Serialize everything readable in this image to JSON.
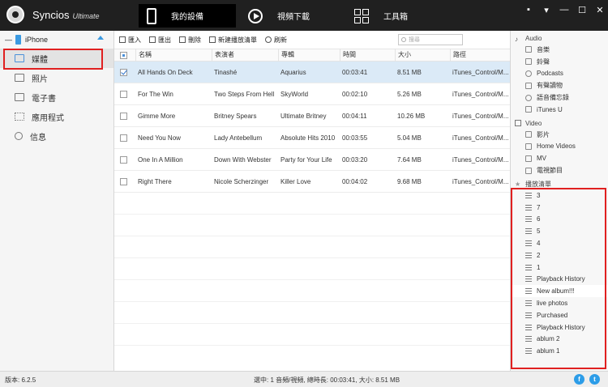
{
  "app": {
    "name": "Syncios",
    "edition": "Ultimate"
  },
  "top_tabs": [
    {
      "label": "我的設備",
      "icon": "phone-icon"
    },
    {
      "label": "視頻下載",
      "icon": "play-icon"
    },
    {
      "label": "工具箱",
      "icon": "toolbox-icon"
    }
  ],
  "window_controls": [
    "feedback-icon",
    "dropdown-icon",
    "minimize-icon",
    "maximize-icon",
    "close-icon"
  ],
  "device": {
    "name": "iPhone"
  },
  "sidebar": {
    "items": [
      {
        "label": "媒體",
        "icon": "media-icon",
        "active": true
      },
      {
        "label": "照片",
        "icon": "photo-icon"
      },
      {
        "label": "電子書",
        "icon": "ebook-icon"
      },
      {
        "label": "應用程式",
        "icon": "apps-icon"
      },
      {
        "label": "信息",
        "icon": "info-icon"
      }
    ]
  },
  "toolbar": {
    "import": "匯入",
    "export": "匯出",
    "delete": "刪除",
    "new_playlist": "新建播放清單",
    "refresh": "刷新",
    "search_placeholder": "搜尋"
  },
  "table": {
    "headers": [
      "名稱",
      "表演者",
      "專輯",
      "時間",
      "大小",
      "路徑"
    ],
    "rows": [
      {
        "name": "All Hands On Deck",
        "artist": "Tinashé",
        "album": "Aquarius",
        "time": "00:03:41",
        "size": "8.51 MB",
        "path": "iTunes_Control/M...",
        "checked": true
      },
      {
        "name": "For The Win",
        "artist": "Two Steps From Hell",
        "album": "SkyWorld",
        "time": "00:02:10",
        "size": "5.26 MB",
        "path": "iTunes_Control/M..."
      },
      {
        "name": "Gimme More",
        "artist": "Britney Spears",
        "album": "Ultimate Britney",
        "time": "00:04:11",
        "size": "10.26 MB",
        "path": "iTunes_Control/M..."
      },
      {
        "name": "Need You Now",
        "artist": "Lady Antebellum",
        "album": "Absolute Hits 2010",
        "time": "00:03:55",
        "size": "5.04 MB",
        "path": "iTunes_Control/M..."
      },
      {
        "name": "One In A Million",
        "artist": "Down With Webster",
        "album": "Party for Your Life",
        "time": "00:03:20",
        "size": "7.64 MB",
        "path": "iTunes_Control/M..."
      },
      {
        "name": "Right There",
        "artist": "Nicole Scherzinger",
        "album": "Killer Love",
        "time": "00:04:02",
        "size": "9.68 MB",
        "path": "iTunes_Control/M..."
      }
    ]
  },
  "right_panel": {
    "audio_label": "Audio",
    "audio_items": [
      "音樂",
      "鈴聲",
      "Podcasts",
      "有聲讀物",
      "語音備忘錄",
      "iTunes U"
    ],
    "video_label": "Video",
    "video_items": [
      "影片",
      "Home Videos",
      "MV",
      "電視節目"
    ],
    "playlist_label": "播放清單",
    "playlist_items": [
      "3",
      "7",
      "6",
      "5",
      "4",
      "2",
      "1",
      "Playback History",
      "New album!!!",
      "live photos",
      "Purchased",
      "Playback History",
      "ablum 2",
      "ablum 1"
    ]
  },
  "status": {
    "version": "版本: 6.2.5",
    "summary": "選中: 1 音頻/視頻, 總時長: 00:03:41, 大小: 8.51 MB"
  },
  "colors": {
    "accent": "#3b9ae1",
    "highlight": "#e02020",
    "titlebar": "#202020",
    "selected_row": "#dbeaf7"
  }
}
